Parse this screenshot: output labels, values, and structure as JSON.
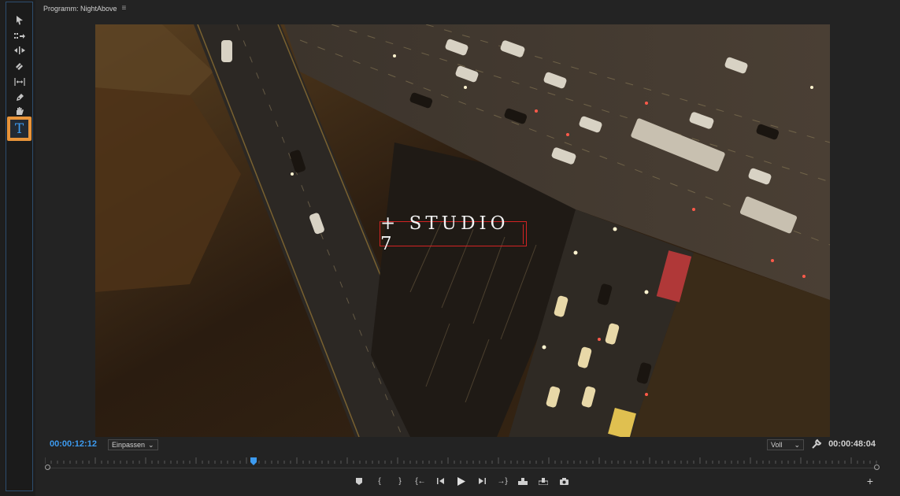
{
  "panel": {
    "title": "Programm: NightAbove"
  },
  "tools": [
    {
      "name": "selection-tool"
    },
    {
      "name": "track-select-tool"
    },
    {
      "name": "ripple-edit-tool"
    },
    {
      "name": "razor-tool"
    },
    {
      "name": "slip-tool"
    },
    {
      "name": "pen-tool"
    },
    {
      "name": "hand-tool"
    },
    {
      "name": "type-tool",
      "active": true,
      "glyph": "T"
    }
  ],
  "overlay": {
    "title_text": "+ STUDIO 7"
  },
  "controls": {
    "current_timecode": "00:00:12:12",
    "duration_timecode": "00:00:48:04",
    "fit_label": "Einpassen",
    "quality_label": "Voll"
  },
  "playhead_fraction": 0.25,
  "colors": {
    "accent_blue": "#3d9bf0",
    "active_tool_highlight": "#e8943a",
    "text_box_border": "#d22323"
  }
}
